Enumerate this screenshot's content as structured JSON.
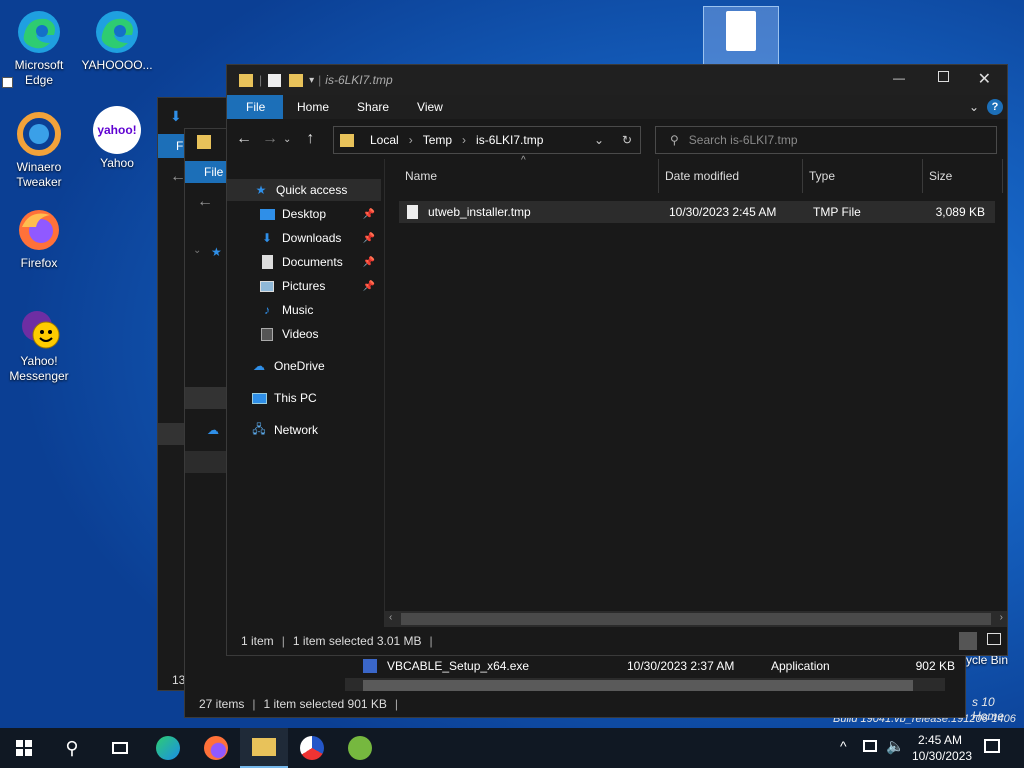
{
  "desktop": {
    "icons": [
      {
        "name": "desktop-icon-edge",
        "label": "Microsoft Edge"
      },
      {
        "name": "desktop-icon-yahoooo",
        "label": "YAHOOOO..."
      },
      {
        "name": "desktop-icon-winaero",
        "label": "Winaero Tweaker"
      },
      {
        "name": "desktop-icon-yahoo",
        "label": "Yahoo"
      },
      {
        "name": "desktop-icon-firefox",
        "label": "Firefox"
      },
      {
        "name": "desktop-icon-messenger",
        "label": "Yahoo! Messenger"
      }
    ],
    "recycle_bin_partial": "ycle Bin",
    "watermark_line1": "s 10 Home",
    "watermark_line2": "Build 19041.vb_release.191206-1406",
    "yahoo_logo_text": "yahoo!"
  },
  "bg_window": {
    "ribbon_file": "File",
    "row_name": "VBCABLE_Setup_x64.exe",
    "row_date": "10/30/2023 2:37 AM",
    "row_type": "Application",
    "row_size": "902 KB",
    "status_items": "27 items",
    "status_selected": "1 item selected  901 KB",
    "partial_count": "13",
    "ribbon_file_back": "F"
  },
  "explorer": {
    "title": "is-6LKI7.tmp",
    "ribbon": {
      "file": "File",
      "home": "Home",
      "share": "Share",
      "view": "View"
    },
    "breadcrumb": {
      "item1": "Local",
      "item2": "Temp",
      "item3": "is-6LKI7.tmp"
    },
    "search_placeholder": "Search is-6LKI7.tmp",
    "nav": {
      "quick_access": "Quick access",
      "desktop": "Desktop",
      "downloads": "Downloads",
      "documents": "Documents",
      "pictures": "Pictures",
      "music": "Music",
      "videos": "Videos",
      "onedrive": "OneDrive",
      "this_pc": "This PC",
      "network": "Network"
    },
    "columns": {
      "name": "Name",
      "date": "Date modified",
      "type": "Type",
      "size": "Size"
    },
    "file": {
      "name": "utweb_installer.tmp",
      "date": "10/30/2023 2:45 AM",
      "type": "TMP File",
      "size": "3,089 KB"
    },
    "status": {
      "items": "1 item",
      "selected": "1 item selected  3.01 MB"
    }
  },
  "taskbar": {
    "time": "2:45 AM",
    "date": "10/30/2023"
  },
  "colors": {
    "accent": "#1c6fb8",
    "window_bg": "#191919",
    "taskbar_bg": "#101823"
  }
}
